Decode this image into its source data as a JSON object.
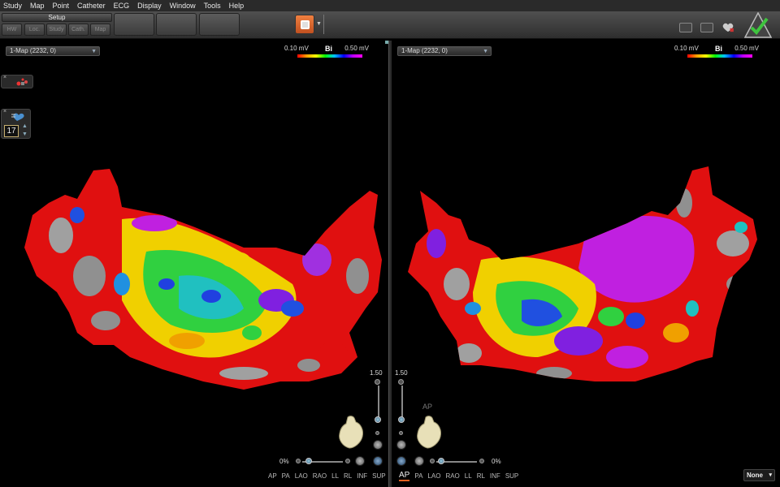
{
  "menu": [
    "Study",
    "Map",
    "Point",
    "Catheter",
    "ECG",
    "Display",
    "Window",
    "Tools",
    "Help"
  ],
  "toolbar": {
    "setup_label": "Setup",
    "setup_buttons": [
      "HW",
      "Loc.",
      "Study",
      "Cath.",
      "Map"
    ],
    "big_buttons": [
      "",
      "",
      ""
    ]
  },
  "viewports": [
    {
      "map_label": "1-Map (2232, 0)",
      "legend": {
        "low": "0.10 mV",
        "mode": "Bi",
        "high": "0.50 mV"
      },
      "zoom": "1.50",
      "rotation_pct": "0%",
      "views": [
        "AP",
        "PA",
        "LAO",
        "RAO",
        "LL",
        "RL",
        "INF",
        "SUP"
      ]
    },
    {
      "map_label": "1-Map (2232, 0)",
      "legend": {
        "low": "0.10 mV",
        "mode": "Bi",
        "high": "0.50 mV"
      },
      "zoom": "1.50",
      "rotation_pct": "0%",
      "orientation_label": "AP",
      "views": [
        "AP",
        "PA",
        "LAO",
        "RAO",
        "LL",
        "RL",
        "INF",
        "SUP"
      ],
      "active_view": "AP"
    }
  ],
  "left_widget": {
    "number": "17"
  },
  "bottom_right_select": "None",
  "icons": [
    "orange-map-tool-icon",
    "monitor-icon",
    "screen-icon",
    "heart-tool-icon",
    "status-checkmark-icon"
  ]
}
